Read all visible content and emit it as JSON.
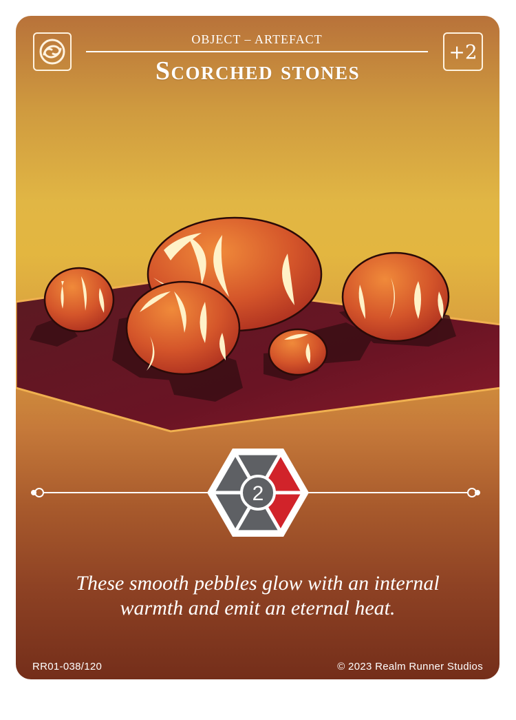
{
  "card": {
    "subtype": "OBJECT – ARTEFACT",
    "name": "Scorched stones",
    "bonus": "+2",
    "cost": "2",
    "flavor_text_line1": "These smooth pebbles glow with an internal",
    "flavor_text_line2": "warmth and emit an eternal heat.",
    "set_number": "RR01-038/120",
    "copyright": "© 2023 Realm Runner Studios",
    "type_icon": "swirl-knot-icon",
    "art_subject": "glowing-stones-illustration"
  },
  "colors": {
    "accent_red": "#d1232a",
    "hex_gray": "#5e6064",
    "text": "#ffffff"
  }
}
